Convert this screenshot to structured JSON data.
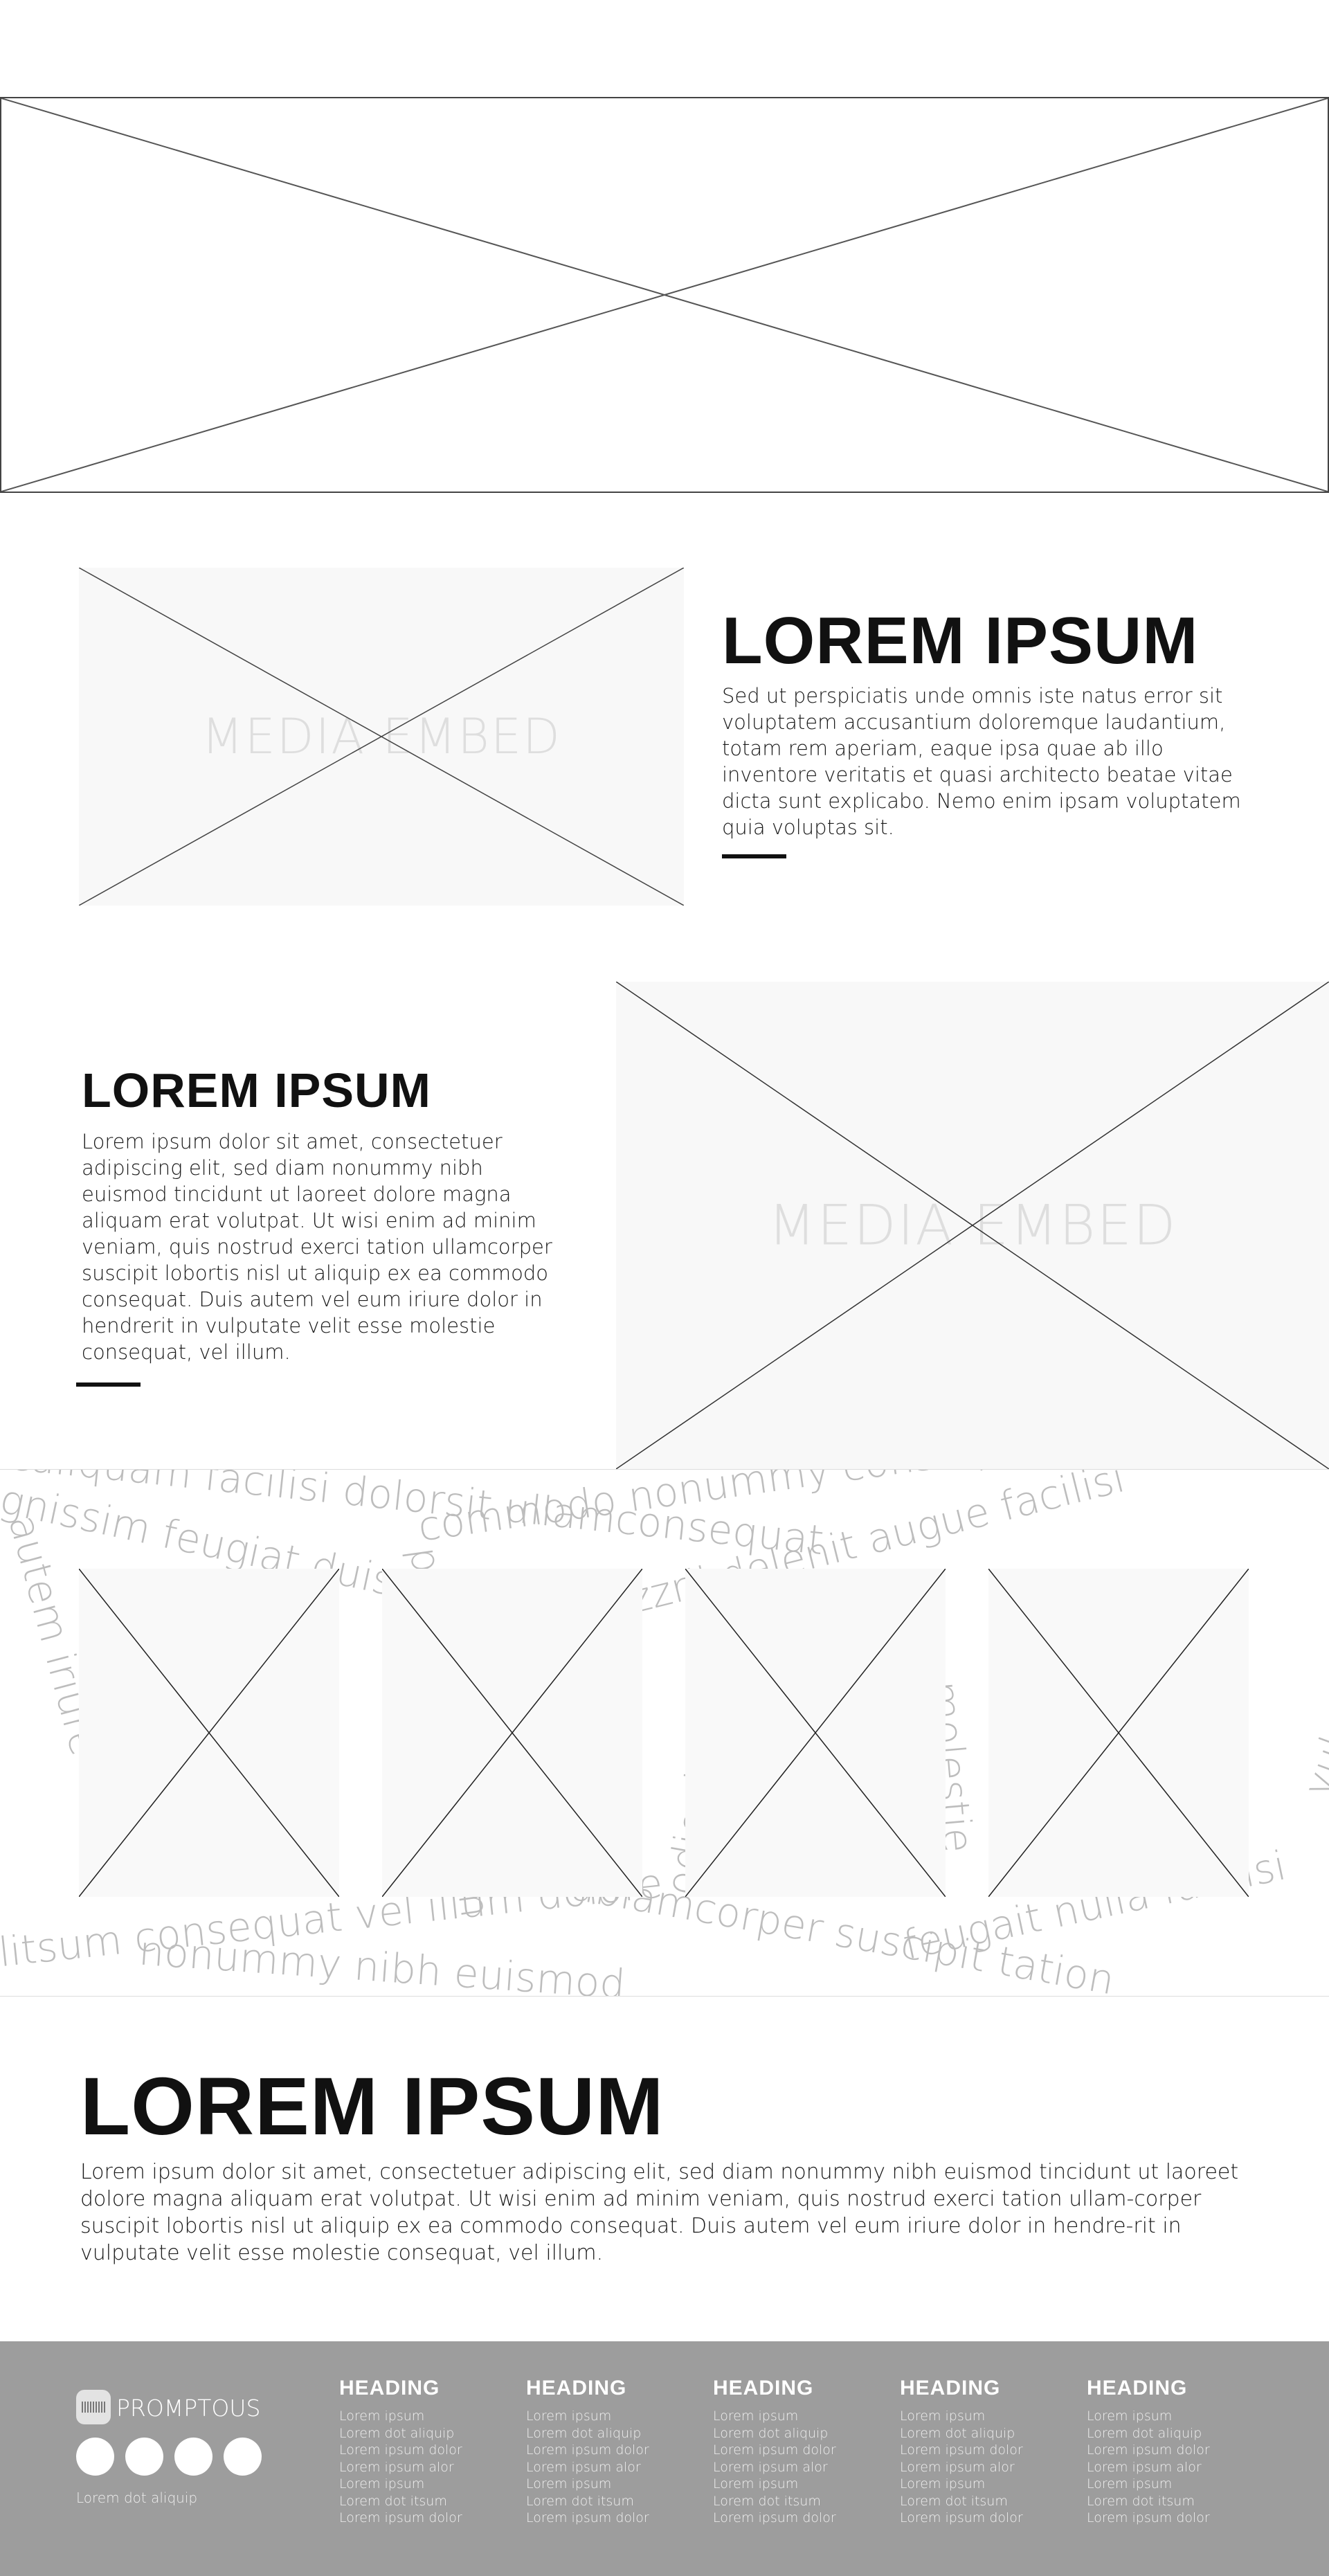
{
  "hero": {},
  "section1": {
    "media_label": "MEDIA EMBED",
    "title": "LOREM IPSUM",
    "text": "Sed ut perspiciatis unde omnis iste natus error sit voluptatem accusantium doloremque laudantium, totam rem aperiam, eaque ipsa quae ab illo inventore veritatis et quasi architecto beatae vitae dicta sunt explicabo. Nemo enim ipsam voluptatem quia voluptas sit."
  },
  "section2": {
    "title": "LOREM IPSUM",
    "text": "Lorem ipsum dolor sit amet, consectetuer adipiscing elit, sed diam nonummy nibh euismod tincidunt ut laoreet dolore magna aliquam erat volutpat. Ut wisi enim ad minim veniam, quis nostrud exerci tation ullamcorper suscipit lobortis nisl ut aliquip ex ea commodo consequat. Duis autem vel eum iriure dolor in hendrerit in vulputate velit esse molestie consequat, vel illum.",
    "media_label": "MEDIA EMBED"
  },
  "section3": {
    "title": "LOREM IPSUM",
    "text": "Lorem ipsum dolor sit amet, consectetuer adipiscing elit, sed diam nonummy nibh euismod tincidunt ut laoreet dolore magna aliquam erat volutpat. Ut wisi enim ad minim veniam, quis nostrud exerci tation ullam-corper suscipit lobortis nisl ut aliquip ex ea commodo consequat. Duis autem vel eum iriure dolor in hendre-rit in vulputate velit esse molestie consequat, vel illum."
  },
  "footer": {
    "brand": "PROMPTOUS",
    "tagline": "Lorem dot aliquip",
    "columns": [
      {
        "heading": "HEADING",
        "links": [
          "Lorem ipsum",
          "Lorem dot aliquip",
          "Lorem ipsum dolor",
          "Lorem ipsum alor",
          "Lorem ipsum",
          "Lorem dot itsum",
          "Lorem ipsum dolor"
        ]
      },
      {
        "heading": "HEADING",
        "links": [
          "Lorem ipsum",
          "Lorem dot aliquip",
          "Lorem ipsum dolor",
          "Lorem ipsum alor",
          "Lorem ipsum",
          "Lorem dot itsum",
          "Lorem ipsum dolor"
        ]
      },
      {
        "heading": "HEADING",
        "links": [
          "Lorem ipsum",
          "Lorem dot aliquip",
          "Lorem ipsum dolor",
          "Lorem ipsum alor",
          "Lorem ipsum",
          "Lorem dot itsum",
          "Lorem ipsum dolor"
        ]
      },
      {
        "heading": "HEADING",
        "links": [
          "Lorem ipsum",
          "Lorem dot aliquip",
          "Lorem ipsum dolor",
          "Lorem ipsum alor",
          "Lorem ipsum",
          "Lorem dot itsum",
          "Lorem ipsum dolor"
        ]
      },
      {
        "heading": "HEADING",
        "links": [
          "Lorem ipsum",
          "Lorem dot aliquip",
          "Lorem ipsum dolor",
          "Lorem ipsum alor",
          "Lorem ipsum",
          "Lorem dot itsum",
          "Lorem ipsum dolor"
        ]
      }
    ]
  }
}
